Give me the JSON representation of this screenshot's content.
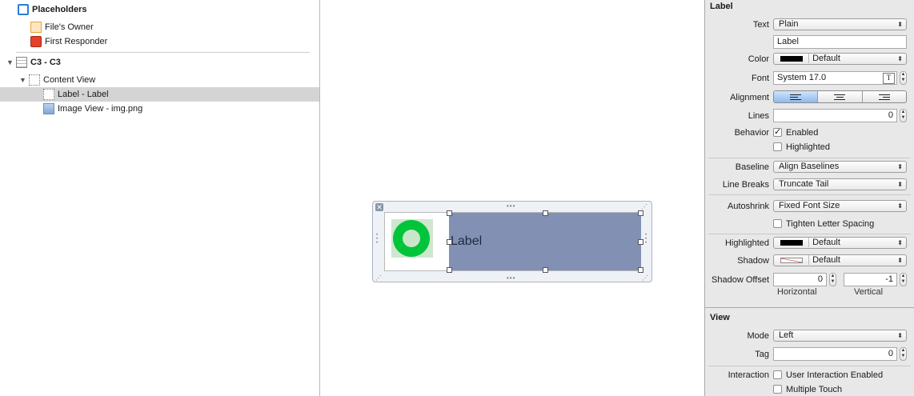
{
  "outline": {
    "placeholders_title": "Placeholders",
    "files_owner": "File's Owner",
    "first_responder": "First Responder",
    "cell": "C3 - C3",
    "content_view": "Content View",
    "label": "Label - Label",
    "image_view": "Image View - img.png"
  },
  "canvas": {
    "label_text": "Label",
    "close_glyph": "✕"
  },
  "inspector": {
    "label_section": "Label",
    "text_label": "Text",
    "text_value": "Plain",
    "text_field_value": "Label",
    "color_label": "Color",
    "color_value": "Default",
    "font_label": "Font",
    "font_value": "System 17.0",
    "font_button": "T",
    "alignment_label": "Alignment",
    "lines_label": "Lines",
    "lines_value": "0",
    "behavior_label": "Behavior",
    "enabled_label": "Enabled",
    "highlighted_chk_label": "Highlighted",
    "baseline_label": "Baseline",
    "baseline_value": "Align Baselines",
    "linebreaks_label": "Line Breaks",
    "linebreaks_value": "Truncate Tail",
    "autoshrink_label": "Autoshrink",
    "autoshrink_value": "Fixed Font Size",
    "tighten_label": "Tighten Letter Spacing",
    "highlighted_label": "Highlighted",
    "highlighted_value": "Default",
    "shadow_label": "Shadow",
    "shadow_value": "Default",
    "shadow_offset_label": "Shadow Offset",
    "shadow_h_value": "0",
    "shadow_v_value": "-1",
    "horizontal_caption": "Horizontal",
    "vertical_caption": "Vertical",
    "view_section": "View",
    "mode_label": "Mode",
    "mode_value": "Left",
    "tag_label": "Tag",
    "tag_value": "0",
    "interaction_label": "Interaction",
    "user_interaction_label": "User Interaction Enabled",
    "multiple_touch_label": "Multiple Touch",
    "checkmark": "✓",
    "popup_arrow": "⬍",
    "stepper_glyph_up": "▲",
    "stepper_glyph_down": "▼"
  },
  "colors": {
    "selection": "#d4d4d4",
    "label_bg": "#8190b3",
    "ring": "#00c43a",
    "alignment_selected": "#8db9f0"
  }
}
